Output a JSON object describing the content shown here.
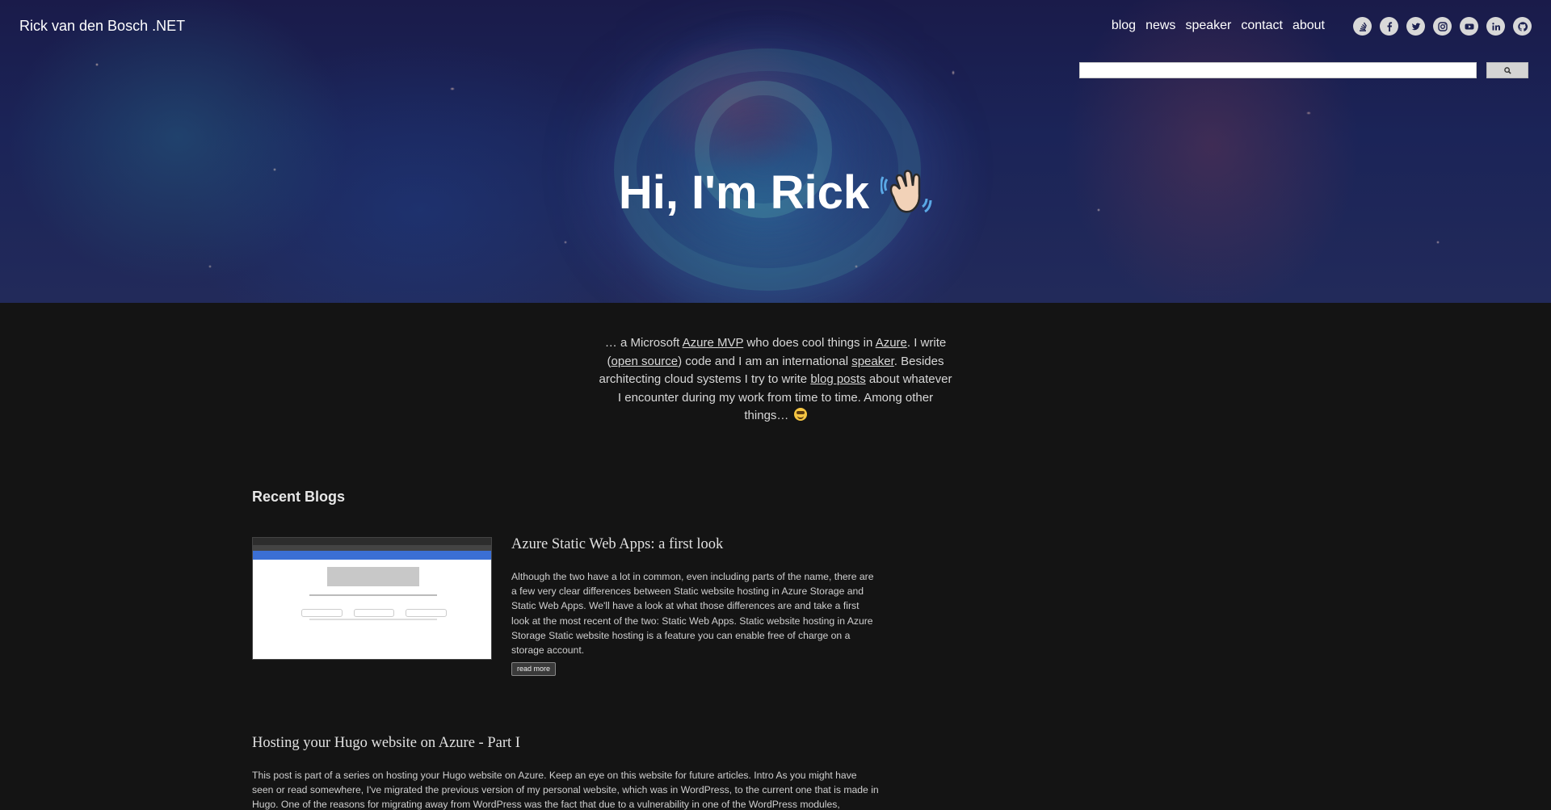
{
  "header": {
    "site_title": "Rick van den Bosch .NET",
    "nav": [
      {
        "label": "blog"
      },
      {
        "label": "news"
      },
      {
        "label": "speaker"
      },
      {
        "label": "contact"
      },
      {
        "label": "about"
      }
    ],
    "social_icons": [
      "stackoverflow-icon",
      "facebook-icon",
      "twitter-icon",
      "instagram-icon",
      "youtube-icon",
      "linkedin-icon",
      "github-icon"
    ]
  },
  "search": {
    "placeholder": "",
    "button_icon": "search-icon"
  },
  "hero": {
    "heading": "Hi, I'm Rick",
    "emoji": "waving-hand-icon"
  },
  "intro": {
    "p1": "… a Microsoft ",
    "link_mvp": "Azure MVP",
    "p2": " who does cool things in ",
    "link_azure": "Azure",
    "p3": ". I write (",
    "link_oss": "open source",
    "p4": ") code and I am an international ",
    "link_speaker": "speaker",
    "p5": ". Besides architecting cloud systems I try to write ",
    "link_blog": "blog posts",
    "p6": " about whatever I encounter during my work from time to time. Among other things… "
  },
  "recent_blogs": {
    "heading": "Recent Blogs",
    "posts": [
      {
        "title": "Azure Static Web Apps: a first look",
        "excerpt": "Although the two have a lot in common, even including parts of the name, there are a few very clear differences between Static website hosting in Azure Storage and Static Web Apps. We'll have a look at what those differences are and take a first look at the most recent of the two: Static Web Apps. Static website hosting in Azure Storage Static website hosting is a feature you can enable free of charge on a storage account.",
        "read_more": "read more"
      },
      {
        "title": "Hosting your Hugo website on Azure - Part I",
        "excerpt": "This post is part of a series on hosting your Hugo website on Azure. Keep an eye on this website for future articles. Intro As you might have seen or read somewhere, I've migrated the previous version of my personal website, which was in WordPress, to the current one that is made in Hugo. One of the reasons for migrating away from WordPress was the fact that due to a vulnerability in one of the WordPress modules,"
      }
    ]
  }
}
